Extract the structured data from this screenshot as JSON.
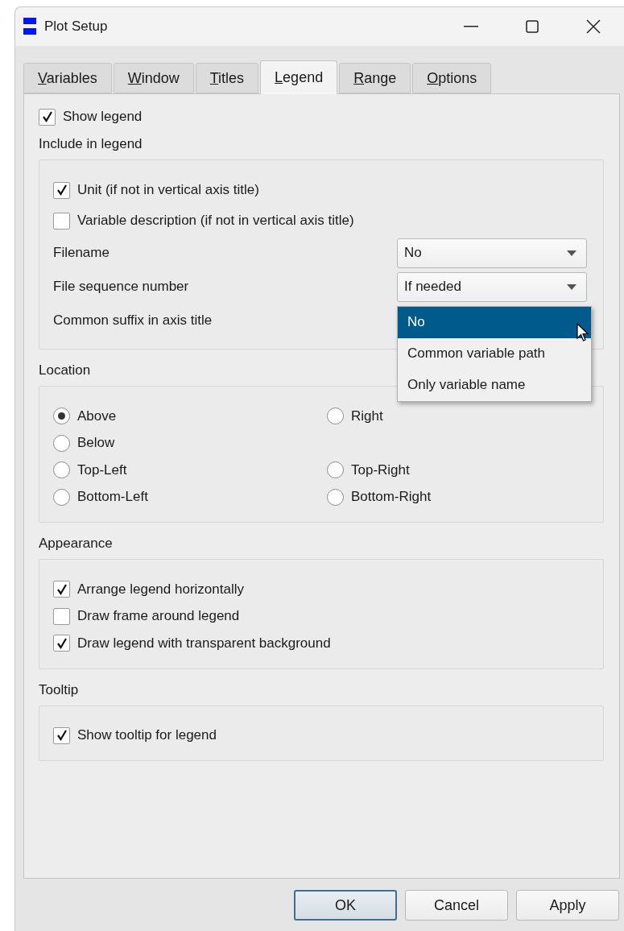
{
  "window": {
    "title": "Plot Setup"
  },
  "tabs": [
    {
      "label": "Variables",
      "selected": false
    },
    {
      "label": "Window",
      "selected": false
    },
    {
      "label": "Titles",
      "selected": false
    },
    {
      "label": "Legend",
      "selected": true
    },
    {
      "label": "Range",
      "selected": false
    },
    {
      "label": "Options",
      "selected": false
    }
  ],
  "show_legend": {
    "label": "Show legend",
    "checked": true
  },
  "include": {
    "title": "Include in legend",
    "rows": [
      {
        "kind": "checkbox",
        "label": "Unit (if not in vertical axis title)",
        "checked": true
      },
      {
        "kind": "checkbox",
        "label": "Variable description (if not in vertical axis title)",
        "checked": false
      },
      {
        "kind": "combo",
        "label": "Filename",
        "value": "No"
      },
      {
        "kind": "combo",
        "label": "File sequence number",
        "value": "If needed"
      },
      {
        "kind": "open_combo",
        "label": "Common suffix in axis title",
        "options": [
          {
            "label": "No",
            "selected": true
          },
          {
            "label": "Common variable path",
            "selected": false
          },
          {
            "label": "Only variable name",
            "selected": false
          }
        ]
      }
    ]
  },
  "location": {
    "title": "Location",
    "rows": [
      [
        {
          "label": "Above",
          "selected": true
        },
        {
          "label": "Right",
          "selected": false
        }
      ],
      [
        {
          "label": "Below",
          "selected": false
        }
      ],
      [
        {
          "label": "Top-Left",
          "selected": false
        },
        {
          "label": "Top-Right",
          "selected": false
        }
      ],
      [
        {
          "label": "Bottom-Left",
          "selected": false
        },
        {
          "label": "Bottom-Right",
          "selected": false
        }
      ]
    ]
  },
  "appearance": {
    "title": "Appearance",
    "items": [
      {
        "label": "Arrange legend horizontally",
        "checked": true
      },
      {
        "label": "Draw frame around legend",
        "checked": false
      },
      {
        "label": "Draw legend with transparent background",
        "checked": true
      }
    ]
  },
  "tooltip": {
    "title": "Tooltip",
    "items": [
      {
        "label": "Show tooltip for legend",
        "checked": true
      }
    ]
  },
  "buttons": [
    {
      "label": "OK",
      "default": true
    },
    {
      "label": "Cancel",
      "default": false
    },
    {
      "label": "Apply",
      "default": false
    }
  ]
}
